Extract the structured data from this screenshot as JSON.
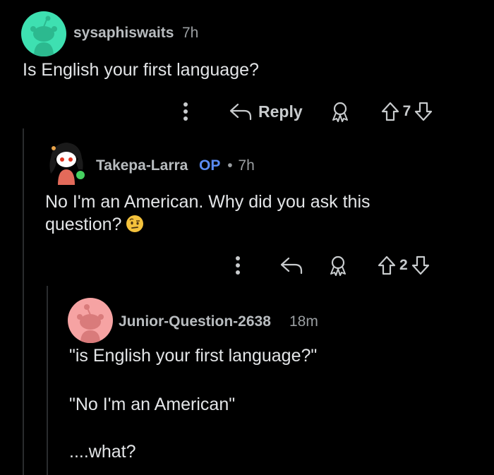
{
  "comments": [
    {
      "username": "sysaphiswaits",
      "time": "7h",
      "body": "Is English your first language?",
      "reply_label": "Reply",
      "votes": "7",
      "avatar_color": "#3ee0b1"
    },
    {
      "username": "Takepa-Larra",
      "op_badge": "OP",
      "separator": "•",
      "time": "7h",
      "body": "No I'm an American. Why did you ask this question?",
      "emoji": "face-with-raised-eyebrow",
      "votes": "2",
      "online_color": "#46d160"
    },
    {
      "username": "Junior-Question-2638",
      "time": "18m",
      "body_lines": [
        "\"is English your first language?\"",
        "\"No I'm an American\"",
        "....what?"
      ],
      "avatar_color": "#f6a3a3"
    }
  ],
  "icons": {
    "more": "more-vertical-icon",
    "reply": "reply-arrow-icon",
    "award": "award-icon",
    "upvote": "upvote-arrow-icon",
    "downvote": "downvote-arrow-icon"
  }
}
